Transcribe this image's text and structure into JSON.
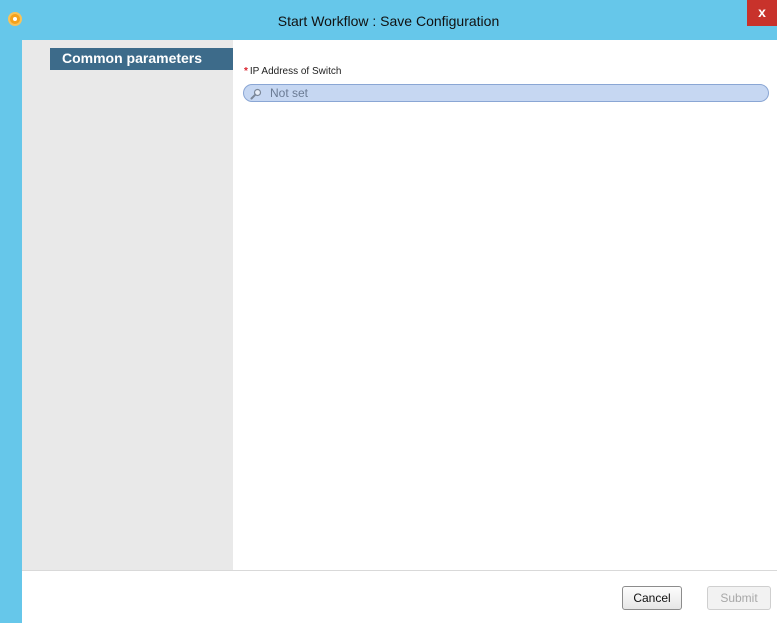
{
  "window": {
    "title": "Start Workflow : Save Configuration",
    "close_label": "x"
  },
  "sidebar": {
    "items": [
      {
        "label": "Common parameters",
        "selected": true
      }
    ]
  },
  "form": {
    "fields": [
      {
        "required_marker": "*",
        "label": "IP Address of Switch",
        "value": "Not set",
        "icon": "search-icon"
      }
    ]
  },
  "footer": {
    "cancel_label": "Cancel",
    "submit_label": "Submit",
    "submit_enabled": false
  },
  "colors": {
    "titlebar": "#66c7ea",
    "sidebar": "#e9e9e9",
    "selected_item": "#3d6b8a",
    "input_fill": "#c6d7f2",
    "close_button": "#c8322b",
    "required": "#d9232e"
  }
}
